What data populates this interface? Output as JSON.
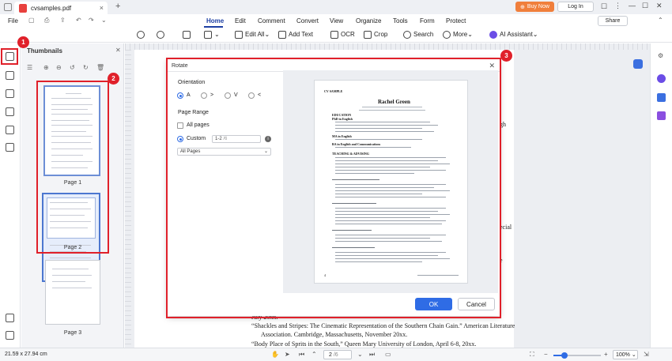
{
  "window": {
    "tab_title": "cvsamples.pdf",
    "buy_now": "Buy Now",
    "login": "Log In"
  },
  "menu": {
    "file": "File",
    "items": [
      "Home",
      "Edit",
      "Comment",
      "Convert",
      "View",
      "Organize",
      "Tools",
      "Form",
      "Protect"
    ],
    "share": "Share"
  },
  "toolbar": {
    "edit_all": "Edit All",
    "add_text": "Add Text",
    "ocr": "OCR",
    "crop": "Crop",
    "search": "Search",
    "more": "More",
    "ai_assistant": "AI Assistant"
  },
  "thumbnails": {
    "title": "Thumbnails",
    "pages": [
      "Page 1",
      "Page 2",
      "Page 3"
    ]
  },
  "dialog": {
    "title": "Rotate",
    "orientation_label": "Orientation",
    "orientations": [
      "A",
      ">",
      "V",
      "<"
    ],
    "page_range_label": "Page Range",
    "all_pages": "All pages",
    "custom": "Custom",
    "custom_value": "1-2",
    "custom_total": "/6",
    "info": "i",
    "subset_select": "All Pages",
    "ok": "OK",
    "cancel": "Cancel"
  },
  "preview": {
    "header": "CV SAMPLE",
    "name": "Rachel Green",
    "education": "EDUCATION",
    "phd": "PhD in English",
    "ma": "MA in English",
    "ba": "BA in English and Communications",
    "teaching": "TEACHING & ADVISING",
    "page_number": "4"
  },
  "document": {
    "frag_1": "gh",
    "frag_2": "ecial",
    "frag_3": "e",
    "line_july": "July 20xx.",
    "line_shackles_1": "“Shackles and Stripes: The Cinematic Representation of the Southern Chain Gain.” American Literature",
    "line_shackles_2": "Association. Cambridge, Massachusetts, November 20xx.",
    "line_body": "“Body Place of Sprits in the South,” Queen Mary University of London, April 6-8, 20xx."
  },
  "status": {
    "dimensions": "21.59 x 27.94 cm",
    "page_current": "2",
    "page_total": "/6",
    "zoom": "100%"
  },
  "badges": [
    "1",
    "2",
    "3"
  ],
  "colors": {
    "accent": "#2f6ce5",
    "annotation": "#e0202a",
    "buy_now": "#f07f3c"
  }
}
